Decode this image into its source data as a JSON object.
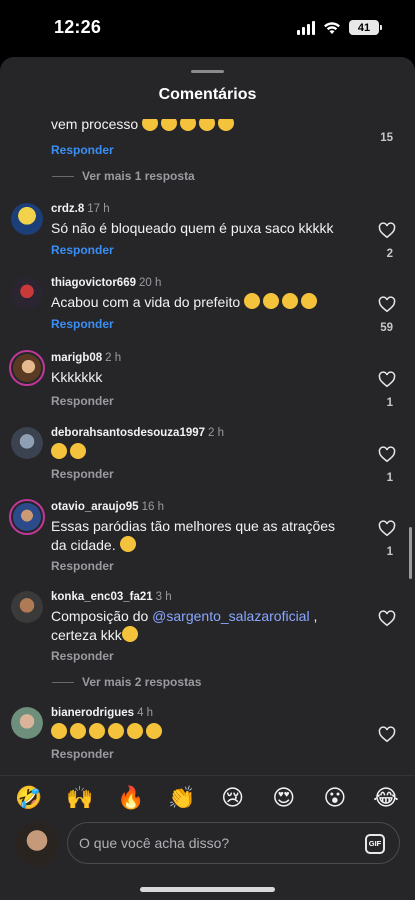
{
  "status": {
    "time": "12:26",
    "battery": "41"
  },
  "sheet": {
    "title": "Comentários"
  },
  "top_partial": {
    "text_start": "vem processo",
    "reply": "Responder",
    "likes": "15",
    "view_more": "Ver mais 1 resposta"
  },
  "comments": [
    {
      "user": "crdz.8",
      "time": "17 h",
      "text": "Só não é bloqueado quem é puxa saco kkkkk",
      "reply": "Responder",
      "likes": "2"
    },
    {
      "user": "thiagovictor669",
      "time": "20 h",
      "text": "Acabou com a vida do prefeito",
      "reply": "Responder",
      "likes": "59"
    },
    {
      "user": "marigb08",
      "time": "2 h",
      "text": "Kkkkkkk",
      "reply": "Responder",
      "likes": "1"
    },
    {
      "user": "deborahsantosdesouza1997",
      "time": "2 h",
      "text": "",
      "reply": "Responder",
      "likes": "1"
    },
    {
      "user": "otavio_araujo95",
      "time": "16 h",
      "text": "Essas paródias tão melhores que as atrações da cidade.",
      "reply": "Responder",
      "likes": "1"
    },
    {
      "user": "konka_enc03_fa21",
      "time": "3 h",
      "text_start": "Composição do ",
      "mention": "@sargento_salazaroficial",
      "text_end": " ,",
      "text_line2": "certeza kkk",
      "reply": "Responder",
      "view_more": "Ver mais 2 respostas"
    },
    {
      "user": "bianerodrigues",
      "time": "4 h",
      "text": "",
      "reply": "Responder"
    }
  ],
  "emoji_bar": [
    "🤣",
    "🙌",
    "🔥",
    "👏",
    "😢",
    "😍",
    "😮",
    "😂"
  ],
  "composer": {
    "placeholder": "O que você acha disso?",
    "gif_label": "GIF"
  },
  "colors": {
    "sheet_bg": "#262629",
    "accent_blue": "#3a8ff5",
    "mention": "#8aa7ff"
  }
}
